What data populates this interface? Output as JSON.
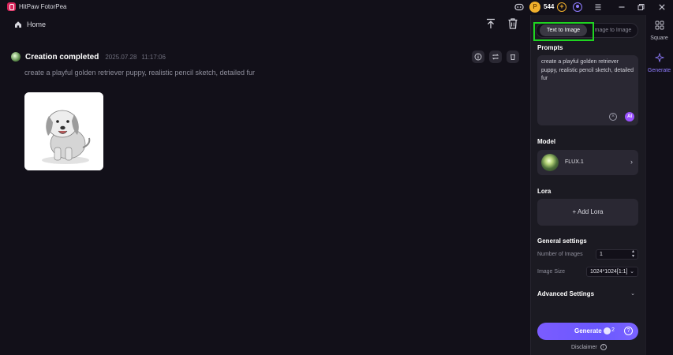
{
  "window": {
    "title": "HitPaw FotorPea",
    "coins": "544",
    "controls": [
      "discord-icon",
      "coin-icon",
      "add-coins-icon",
      "user-icon",
      "menu-icon",
      "minimize-icon",
      "restore-icon",
      "close-icon"
    ]
  },
  "header": {
    "home_label": "Home"
  },
  "result": {
    "title": "Creation completed",
    "date": "2025.07.28",
    "time": "11:17:06",
    "prompt": "create a playful golden retriever puppy, realistic pencil sketch, detailed fur"
  },
  "panel": {
    "tabs": [
      {
        "label": "Text to Image",
        "active": true
      },
      {
        "label": "Image to Image",
        "active": false
      }
    ],
    "prompts_title": "Prompts",
    "prompt_value": "create a playful golden retriever puppy, realistic pencil sketch, detailed fur",
    "model_title": "Model",
    "model_name": "FLUX.1",
    "lora_title": "Lora",
    "lora_button": "+ Add Lora",
    "general_title": "General settings",
    "num_images_label": "Number of Images",
    "num_images_value": "1",
    "image_size_label": "Image Size",
    "image_size_value": "1024*1024[1:1]",
    "advanced_title": "Advanced Settings",
    "generate_label": "Generate",
    "generate_cost": "2",
    "disclaimer": "Disclaimer"
  },
  "sidenav": {
    "items": [
      {
        "label": "Square",
        "active": false
      },
      {
        "label": "Generate",
        "active": true
      }
    ]
  },
  "colors": {
    "accent": "#7b5cff",
    "highlight": "#1fd421",
    "coin": "#f1b02c"
  }
}
